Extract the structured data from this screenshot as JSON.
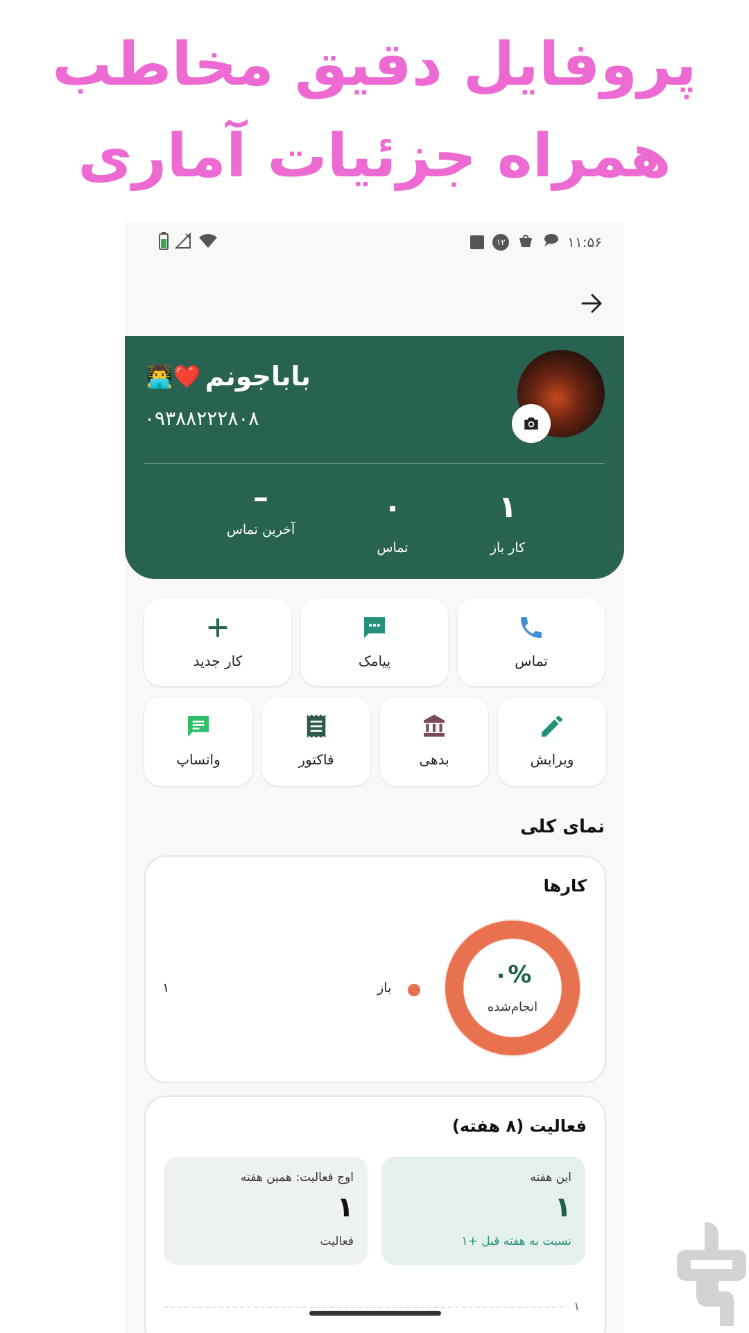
{
  "promo": {
    "line1": "پروفایل دقیق مخاطب",
    "line2": "همراه جزئیات آماری"
  },
  "status_bar": {
    "time": "۱۱:۵۶",
    "notification_count": "۱۲"
  },
  "contact": {
    "name": "باباجونم",
    "name_emoji": "❤️👨‍💻",
    "phone": "۰۹۳۸۸۲۲۲۸۰۸"
  },
  "stats": [
    {
      "value": "۱",
      "label": "کار باز"
    },
    {
      "value": "۰",
      "label": "تماس"
    },
    {
      "value": "–",
      "label": "آخرین تماس"
    }
  ],
  "actions": [
    {
      "label": "تماس",
      "icon": "phone-icon"
    },
    {
      "label": "پیامک",
      "icon": "sms-icon"
    },
    {
      "label": "کار جدید",
      "icon": "plus-icon"
    },
    {
      "label": "ویرایش",
      "icon": "edit-icon"
    },
    {
      "label": "بدهی",
      "icon": "bank-icon"
    },
    {
      "label": "فاکتور",
      "icon": "receipt-icon"
    },
    {
      "label": "واتساپ",
      "icon": "whatsapp-icon"
    }
  ],
  "overview": {
    "title": "نمای کلی",
    "tasks_card": {
      "title": "کارها",
      "percent": "۰%",
      "percent_label": "انجام‌شده",
      "done_fraction": 0,
      "legend": [
        {
          "label": "باز",
          "value": "۱",
          "color": "#e8714f"
        }
      ]
    },
    "activity_card": {
      "title": "فعالیت (۸ هفته)",
      "this_week": {
        "title": "این هفته",
        "value": "۱",
        "sub": "نسبت به هفته قبل +۱"
      },
      "peak": {
        "title": "اوج فعالیت: همین هفته",
        "value": "۱",
        "sub": "فعالیت"
      },
      "axis_label": "۱"
    }
  },
  "colors": {
    "header_green": "#286250",
    "accent_orange": "#e8714f",
    "promo_pink": "#ee6ad3"
  }
}
